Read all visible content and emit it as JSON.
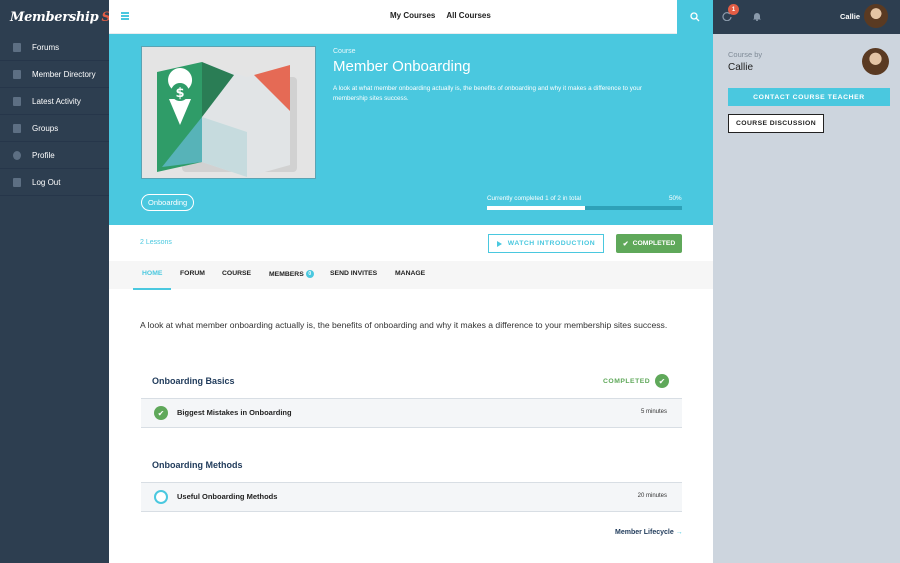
{
  "brand": {
    "name_part1": "Membership",
    "name_part2": "Sites"
  },
  "sidebar": {
    "items": [
      {
        "label": "Forums",
        "icon": "document-icon"
      },
      {
        "label": "Member Directory",
        "icon": "document-icon"
      },
      {
        "label": "Latest Activity",
        "icon": "document-icon"
      },
      {
        "label": "Groups",
        "icon": "document-icon"
      },
      {
        "label": "Profile",
        "icon": "user-icon"
      },
      {
        "label": "Log Out",
        "icon": "logout-icon"
      }
    ]
  },
  "topbar": {
    "links": [
      "My Courses",
      "All Courses"
    ],
    "notification_count": "1",
    "user_name": "Callie"
  },
  "hero": {
    "label": "Course",
    "title": "Member Onboarding",
    "description": "A look at what member onboarding actually is, the benefits of onboarding and why it makes a difference to your membership sites success.",
    "tag": "Onboarding",
    "progress_text": "Currently completed 1 of 2 in total",
    "progress_pct_label": "50%",
    "progress_value": 0.5
  },
  "actions": {
    "lessons_count": "2 Lessons",
    "watch_intro": "WATCH INTRODUCTION",
    "completed": "COMPLETED"
  },
  "tabs": {
    "home": "HOME",
    "forum": "FORUM",
    "course": "COURSE",
    "members": "MEMBERS",
    "members_badge": "0",
    "send_invites": "SEND INVITES",
    "manage": "MANAGE"
  },
  "content": {
    "description": "A look at what member onboarding actually is, the benefits of onboarding and why it makes a difference to your membership sites success.",
    "sections": [
      {
        "title": "Onboarding Basics",
        "status": "COMPLETED",
        "lessons": [
          {
            "name": "Biggest Mistakes in Onboarding",
            "duration": "5 minutes",
            "done": true
          }
        ]
      },
      {
        "title": "Onboarding Methods",
        "lessons": [
          {
            "name": "Useful Onboarding Methods",
            "duration": "20 minutes",
            "done": false
          }
        ]
      }
    ],
    "next_link": "Member Lifecycle"
  },
  "right_panel": {
    "course_by": "Course by",
    "teacher": "Callie",
    "contact_button": "CONTACT COURSE TEACHER",
    "discussion_button": "COURSE DISCUSSION"
  },
  "colors": {
    "accent": "#4ac8df",
    "sidebar": "#2d3e50",
    "success": "#5fa85a",
    "brand_red": "#e35d45",
    "panel": "#cdd5de"
  }
}
